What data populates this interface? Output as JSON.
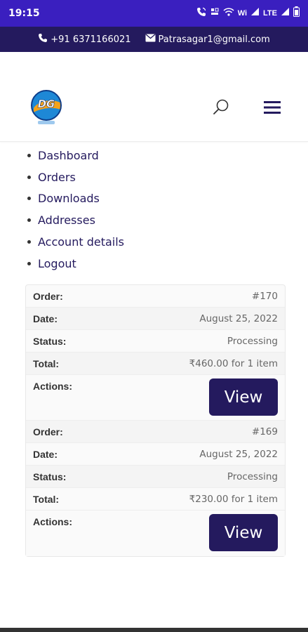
{
  "status_bar": {
    "time": "19:15",
    "icons": [
      "call-icon",
      "data-saver-icon",
      "wifi-calling-icon",
      "signal-1-icon",
      "signal-2-icon",
      "battery-icon"
    ],
    "lte_label": "LTE",
    "wifi_label": "Wi"
  },
  "topbar": {
    "phone": "+91 6371166021",
    "email": "Patrasagar1@gmail.com"
  },
  "header": {
    "logo_text": "DG"
  },
  "account_nav": {
    "items": [
      {
        "label": "Dashboard"
      },
      {
        "label": "Orders"
      },
      {
        "label": "Downloads"
      },
      {
        "label": "Addresses"
      },
      {
        "label": "Account details"
      },
      {
        "label": "Logout"
      }
    ]
  },
  "labels": {
    "order": "Order:",
    "date": "Date:",
    "status": "Status:",
    "total": "Total:",
    "actions": "Actions:",
    "view": "View"
  },
  "orders": [
    {
      "number": "#170",
      "date": "August 25, 2022",
      "status": "Processing",
      "total": "₹460.00 for 1 item"
    },
    {
      "number": "#169",
      "date": "August 25, 2022",
      "status": "Processing",
      "total": "₹230.00 for 1 item"
    }
  ],
  "colors": {
    "status_bar": "#3a1fbf",
    "topbar": "#241a5e",
    "brand": "#241a5e"
  }
}
